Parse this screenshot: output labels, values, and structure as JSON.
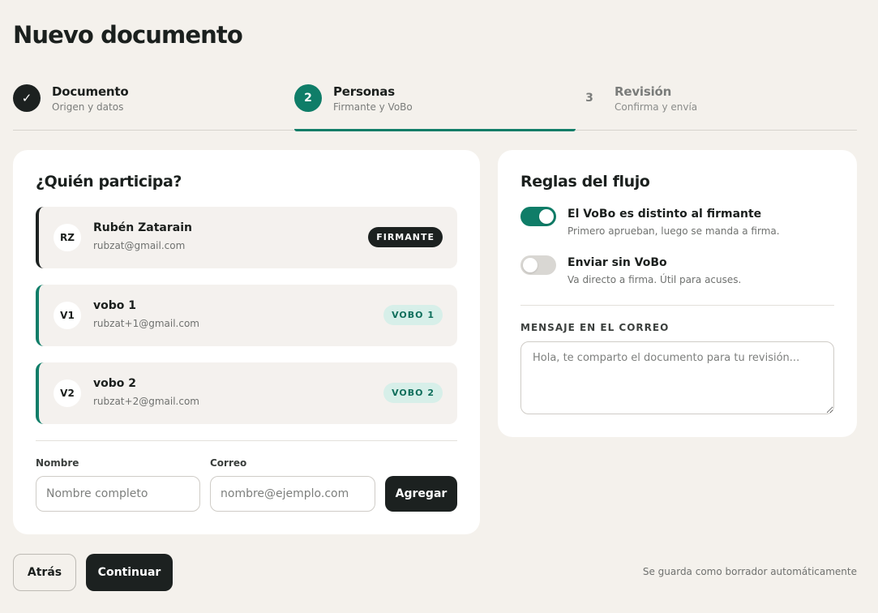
{
  "page": {
    "title": "Nuevo documento"
  },
  "stepper": {
    "steps": [
      {
        "marker": "✓",
        "title": "Documento",
        "subtitle": "Origen y datos",
        "state": "done"
      },
      {
        "marker": "2",
        "title": "Personas",
        "subtitle": "Firmante y VoBo",
        "state": "active"
      },
      {
        "marker": "3",
        "title": "Revisión",
        "subtitle": "Confirma y envía",
        "state": "pending"
      }
    ]
  },
  "participants": {
    "title": "¿Quién participa?",
    "people": [
      {
        "initials": "RZ",
        "name": "Rubén Zatarain",
        "email": "rubzat@gmail.com",
        "role": "FIRMANTE"
      },
      {
        "initials": "V1",
        "name": "vobo 1",
        "email": "rubzat+1@gmail.com",
        "role": "VOBO 1"
      },
      {
        "initials": "V2",
        "name": "vobo 2",
        "email": "rubzat+2@gmail.com",
        "role": "VOBO 2"
      }
    ],
    "form": {
      "name_label": "Nombre",
      "name_placeholder": "Nombre completo",
      "email_label": "Correo",
      "email_placeholder": "nombre@ejemplo.com",
      "add_label": "Agregar"
    }
  },
  "rules": {
    "title": "Reglas del flujo",
    "toggles": [
      {
        "title": "El VoBo es distinto al firmante",
        "description": "Primero aprueban, luego se manda a firma.",
        "on": true
      },
      {
        "title": "Enviar sin VoBo",
        "description": "Va directo a firma. Útil para acuses.",
        "on": false
      }
    ],
    "message_label": "MENSAJE EN EL CORREO",
    "message_placeholder": "Hola, te comparto el documento para tu revisión..."
  },
  "footer": {
    "back_label": "Atrás",
    "continue_label": "Continuar",
    "autosave_note": "Se guarda como borrador automáticamente"
  },
  "colors": {
    "accent": "#0f7d68",
    "dark": "#1c2120",
    "background": "#f4f1ec",
    "badge_teal_bg": "#d7efe9"
  }
}
